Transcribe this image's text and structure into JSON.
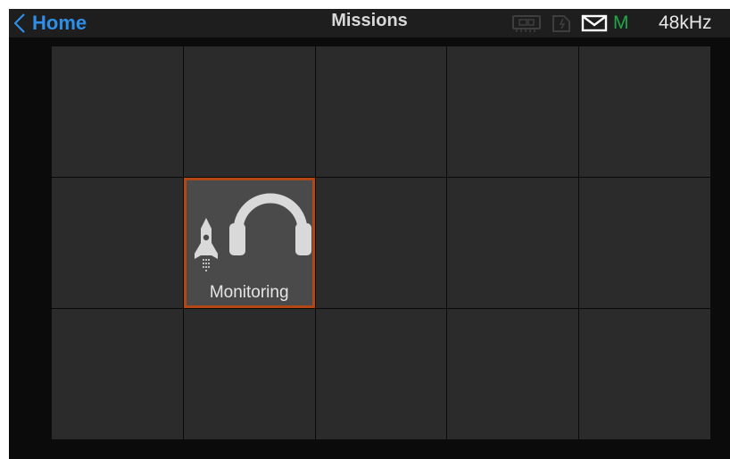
{
  "header": {
    "back_label": "Home",
    "title": "Missions"
  },
  "status": {
    "mode_letter": "M",
    "sample_rate": "48kHz",
    "icons": [
      "memory-card-icon",
      "battery-icon",
      "mail-icon"
    ]
  },
  "colors": {
    "accent_blue": "#2f8fe8",
    "mode_green": "#1fa84a",
    "tile_border": "#b24614"
  },
  "grid": {
    "columns": 5,
    "rows": 3,
    "tiles": [
      {
        "label": "Monitoring",
        "icons": [
          "rocket-icon",
          "headphones-icon"
        ]
      }
    ]
  }
}
